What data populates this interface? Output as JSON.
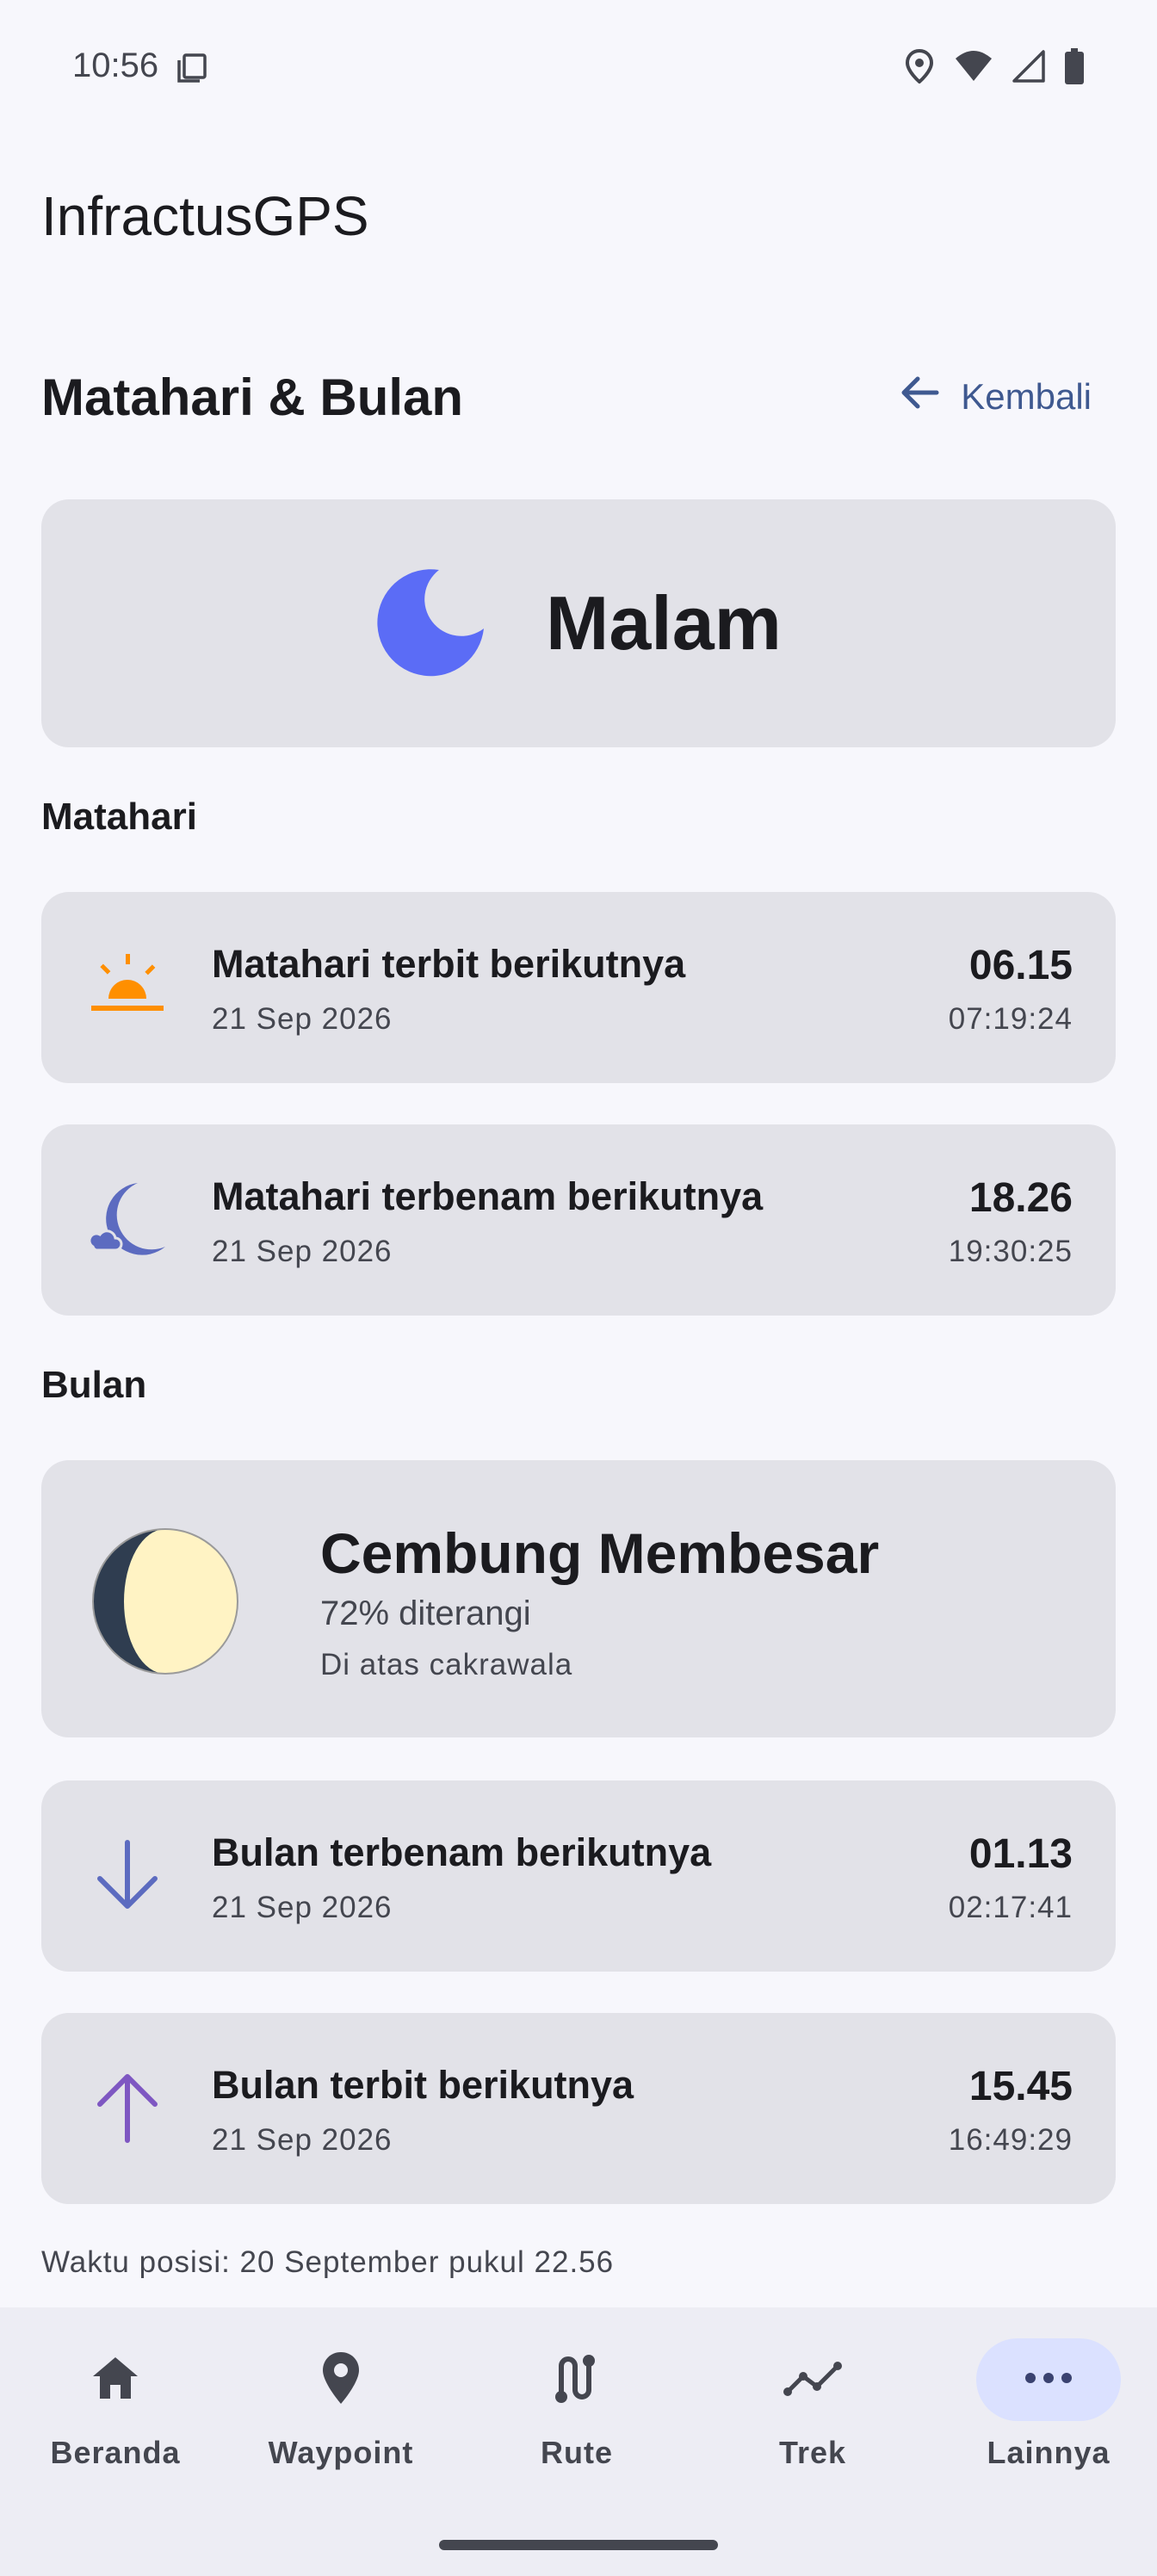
{
  "status_bar": {
    "time": "10:56",
    "icons": [
      "notification-icon",
      "location-icon",
      "wifi-icon",
      "signal-icon",
      "battery-icon"
    ]
  },
  "app": {
    "title": "InfractusGPS"
  },
  "header": {
    "title": "Matahari & Bulan",
    "back_label": "Kembali"
  },
  "hero": {
    "icon": "moon-icon",
    "label": "Malam",
    "icon_color": "#5b6cf6"
  },
  "sun": {
    "section_title": "Matahari",
    "events": [
      {
        "icon": "sunrise-icon",
        "title": "Matahari terbit berikutnya",
        "date": "21 Sep 2026",
        "time": "06.15",
        "exact": "07:19:24",
        "color": "#ff8f00"
      },
      {
        "icon": "sunset-icon",
        "title": "Matahari terbenam berikutnya",
        "date": "21 Sep 2026",
        "time": "18.26",
        "exact": "19:30:25",
        "color": "#5c6bc0"
      }
    ]
  },
  "moon": {
    "section_title": "Bulan",
    "phase": {
      "icon": "moon-phase-icon",
      "name": "Cembung Membesar",
      "illumination": "72% diterangi",
      "position": "Di atas cakrawala",
      "illuminated_fraction": 0.72
    },
    "events": [
      {
        "icon": "arrow-down-icon",
        "title": "Bulan terbenam berikutnya",
        "date": "21 Sep 2026",
        "time": "01.13",
        "exact": "02:17:41",
        "color": "#5c6bc0"
      },
      {
        "icon": "arrow-up-icon",
        "title": "Bulan terbit berikutnya",
        "date": "21 Sep 2026",
        "time": "15.45",
        "exact": "16:49:29",
        "color": "#7e57c2"
      }
    ]
  },
  "footnote": "Waktu posisi: 20 September pukul 22.56",
  "nav": {
    "items": [
      {
        "icon": "home-icon",
        "label": "Beranda",
        "active": false
      },
      {
        "icon": "pin-icon",
        "label": "Waypoint",
        "active": false
      },
      {
        "icon": "route-icon",
        "label": "Rute",
        "active": false
      },
      {
        "icon": "track-icon",
        "label": "Trek",
        "active": false
      },
      {
        "icon": "more-icon",
        "label": "Lainnya",
        "active": true
      }
    ]
  }
}
